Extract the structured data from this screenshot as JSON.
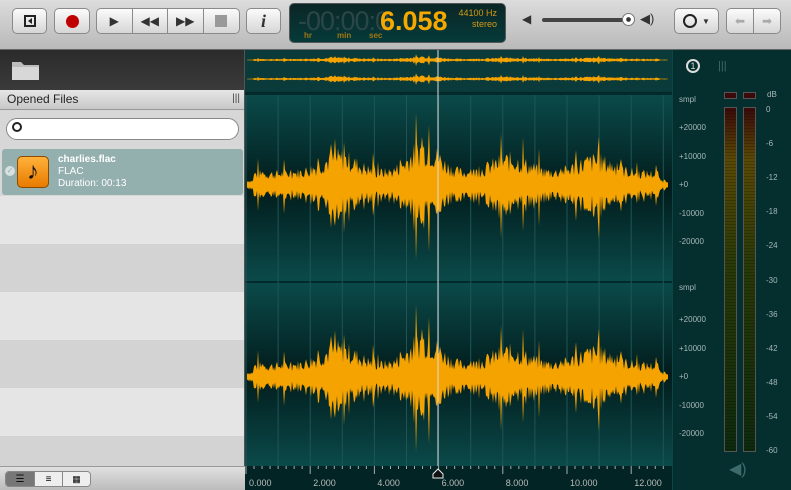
{
  "toolbar": {
    "buttons": [
      {
        "name": "toggle-sidebar",
        "icon": "sidebar-icon"
      },
      {
        "name": "record",
        "icon": "record-icon"
      },
      {
        "name": "play",
        "icon": "play-icon"
      },
      {
        "name": "rewind",
        "icon": "rewind-icon"
      },
      {
        "name": "fast-forward",
        "icon": "fast-forward-icon"
      },
      {
        "name": "stop",
        "icon": "stop-icon"
      },
      {
        "name": "info",
        "icon": "info-icon"
      }
    ],
    "info_label": "i",
    "time_dim": "-00:00:0",
    "time_value": "6.058",
    "time_units": {
      "hr": "hr",
      "min": "min",
      "sec": "sec"
    },
    "sample_rate": "44100 Hz",
    "channels": "stereo",
    "volume": 0.93,
    "history_icon": "clock-icon",
    "record_color": "#c00000"
  },
  "sidebar": {
    "header": "Opened Files",
    "search": {
      "placeholder": "",
      "value": ""
    },
    "files": [
      {
        "name": "charlies.flac",
        "format": "FLAC",
        "duration": "Duration: 00:13",
        "icon": "music-note-icon"
      }
    ],
    "view_modes": [
      "list-detail",
      "list",
      "grid"
    ]
  },
  "waveform": {
    "accent": "#f5a300",
    "channel_axis": {
      "unit": "smpl",
      "ticks": [
        "+20000",
        "+10000",
        "+0",
        "-10000",
        "-20000"
      ]
    },
    "time_ticks": [
      "0.000",
      "2.000",
      "4.000",
      "6.000",
      "8.000",
      "10.000",
      "12.000"
    ],
    "cursor_time": "6.058"
  },
  "meter": {
    "unit": "dB",
    "ticks": [
      "0",
      "-6",
      "-12",
      "-18",
      "-24",
      "-30",
      "-36",
      "-42",
      "-48",
      "-54",
      "-60"
    ]
  }
}
